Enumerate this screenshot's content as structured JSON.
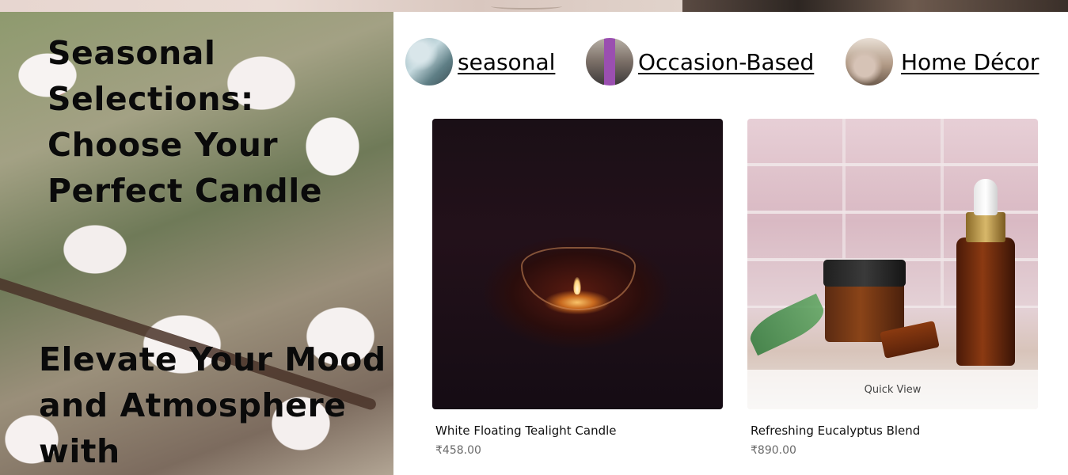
{
  "hero": {
    "heading_1": "Seasonal Selections: Choose Your Perfect Candle",
    "heading_2": "Elevate Your Mood and Atmosphere with"
  },
  "categories": [
    {
      "label": "seasonal",
      "icon": "seasonal-thumbnail"
    },
    {
      "label": "Occasion-Based",
      "icon": "occasion-thumbnail"
    },
    {
      "label": "Home Décor",
      "icon": "home-decor-thumbnail"
    }
  ],
  "products": [
    {
      "name": "White Floating Tealight Candle",
      "price": "₹458.00"
    },
    {
      "name": "Refreshing Eucalyptus Blend",
      "price": "₹890.00",
      "quick_view": "Quick View"
    }
  ]
}
